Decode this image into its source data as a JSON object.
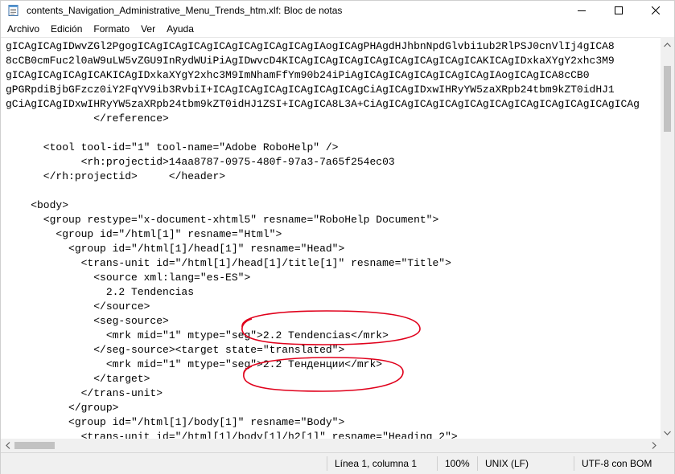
{
  "window": {
    "title": "contents_Navigation_Administrative_Menu_Trends_htm.xlf: Bloc de notas",
    "icons": {
      "app": "notepad-icon",
      "minimize": "minimize-icon",
      "maximize": "maximize-icon",
      "close": "close-icon"
    }
  },
  "menu": {
    "items": [
      "Archivo",
      "Edición",
      "Formato",
      "Ver",
      "Ayuda"
    ]
  },
  "editor": {
    "lines": [
      "gICAgICAgIDwvZGl2PgogICAgICAgICAgICAgICAgICAgICAgIAogICAgPHAgdHJhbnNpdGlvbi1ub2RlPSJ0cnVlIj4gICA8",
      "8cCB0cmFuc2l0aW9uLW5vZGU9InRydWUiPiAgIDwvcD4KICAgICAgICAgICAgICAgICAgICAgICAKICAgIDxkaXYgY2xhc3M9",
      "gICAgICAgICAgICAKICAgIDxkaXYgY2xhc3M9ImNhamFfYm90b24iPiAgICAgICAgICAgICAgICAgIAogICAgICA8cCB0",
      "gPGRpdiBjbGFzcz0iY2FqYV9ib3RvbiI+ICAgICAgICAgICAgICAgICAgCiAgICAgIDxwIHRyYW5zaXRpb24tbm9kZT0idHJ1",
      "gCiAgICAgIDxwIHRyYW5zaXRpb24tbm9kZT0idHJ1ZSI+ICAgICA8L3A+CiAgICAgICAgICAgICAgICAgICAgICAgICAgICAgICAg",
      "              </reference>",
      "",
      "      <tool tool-id=\"1\" tool-name=\"Adobe RoboHelp\" />",
      "            <rh:projectid>14aa8787-0975-480f-97a3-7a65f254ec03",
      "      </rh:projectid>     </header>",
      "",
      "    <body>",
      "      <group restype=\"x-document-xhtml5\" resname=\"RoboHelp Document\">",
      "        <group id=\"/html[1]\" resname=\"Html\">",
      "          <group id=\"/html[1]/head[1]\" resname=\"Head\">",
      "            <trans-unit id=\"/html[1]/head[1]/title[1]\" resname=\"Title\">",
      "              <source xml:lang=\"es-ES\">",
      "                2.2 Tendencias",
      "              </source>",
      "              <seg-source>",
      "                <mrk mid=\"1\" mtype=\"seg\">2.2 Tendencias</mrk>",
      "              </seg-source><target state=\"translated\">",
      "                <mrk mid=\"1\" mtype=\"seg\">2.2 Тенденции</mrk>",
      "              </target>",
      "            </trans-unit>",
      "          </group>",
      "          <group id=\"/html[1]/body[1]\" resname=\"Body\">",
      "            <trans-unit id=\"/html[1]/body[1]/h2[1]\" resname=\"Heading 2\">"
    ]
  },
  "statusbar": {
    "position": "Línea 1, columna 1",
    "zoom": "100%",
    "line_ending": "UNIX (LF)",
    "encoding": "UTF-8 con BOM"
  },
  "colors": {
    "annotation": "#e0001b",
    "scrollbar_track": "#f0f0f0",
    "scrollbar_thumb": "#c2c2c2"
  }
}
